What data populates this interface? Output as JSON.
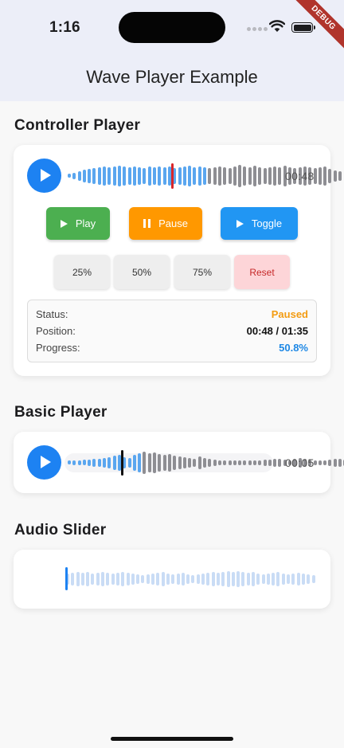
{
  "status_bar": {
    "time": "1:16",
    "debug_label": "DEBUG"
  },
  "app_bar": {
    "title": "Wave Player Example"
  },
  "controller": {
    "section_title": "Controller Player",
    "time": "00:48",
    "progress_fraction": 0.508,
    "buttons": {
      "play": "Play",
      "pause": "Pause",
      "toggle": "Toggle"
    },
    "seek_buttons": {
      "p25": "25%",
      "p50": "50%",
      "p75": "75%",
      "reset": "Reset"
    },
    "info": {
      "status_label": "Status:",
      "status_value": "Paused",
      "position_label": "Position:",
      "position_value": "00:48 / 01:35",
      "progress_label": "Progress:",
      "progress_value": "50.8%"
    }
  },
  "basic": {
    "section_title": "Basic Player",
    "time": "00:05",
    "progress_fraction": 0.27
  },
  "slider": {
    "section_title": "Audio Slider",
    "progress_fraction": 0.0
  },
  "colors": {
    "accent": "#1d82f2",
    "wave_played": "#5aa6ef",
    "wave_unplayed": "#8e8e93",
    "controller_cursor": "#d8262a",
    "basic_cursor": "#111111",
    "slider_wave": "#c9dcf5",
    "play_btn": "#4caf50",
    "pause_btn": "#ff9800",
    "toggle_btn": "#2196f3",
    "reset_bg": "#fdd5d8",
    "reset_text": "#c62828",
    "status_paused": "#f39c12",
    "progress_text": "#1e88e5"
  }
}
